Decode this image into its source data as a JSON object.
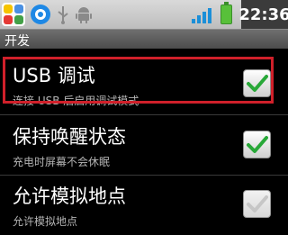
{
  "status_bar": {
    "time": "22:36",
    "icons": [
      "app-grid-icon",
      "browser-circle-icon",
      "usb-icon",
      "android-icon",
      "signal-icon",
      "battery-icon"
    ]
  },
  "title_bar": {
    "title": "开发"
  },
  "settings": [
    {
      "title": "USB 调试",
      "summary": "连接 USB 后启用调试模式",
      "checked": true,
      "enabled": true
    },
    {
      "title": "保持唤醒状态",
      "summary": "充电时屏幕不会休眠",
      "checked": true,
      "enabled": true
    },
    {
      "title": "允许模拟地点",
      "summary": "允许模拟地点",
      "checked": true,
      "enabled": false
    }
  ],
  "colors": {
    "highlight": "#d0202a",
    "check_enabled": "#28a838",
    "check_disabled": "#c6c6c6",
    "signal": "#1b8fd8",
    "battery": "#58c03a"
  }
}
